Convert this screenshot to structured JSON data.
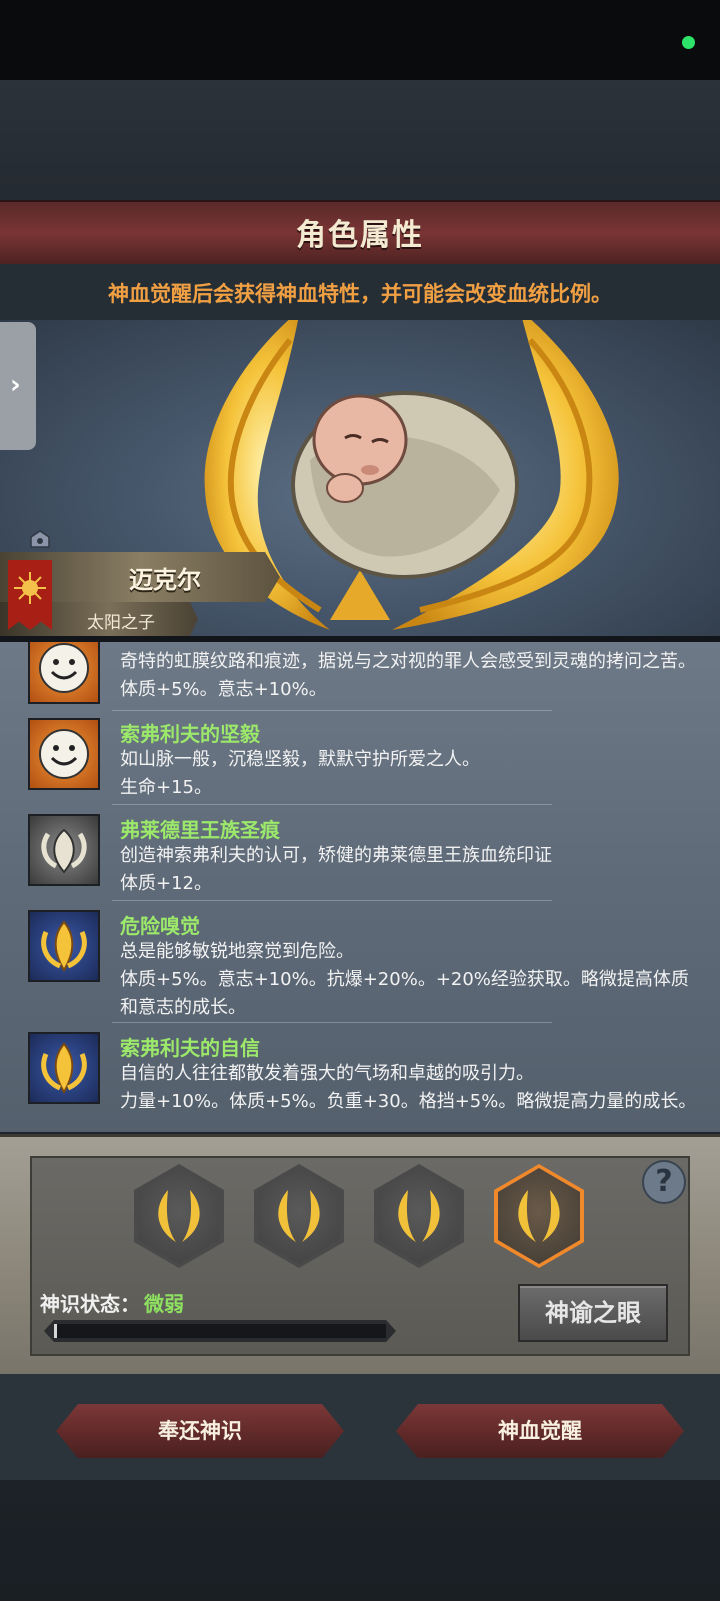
{
  "header": {
    "title": "角色属性",
    "subtitle": "神血觉醒后会获得神血特性，并可能会改变血统比例。"
  },
  "character": {
    "name": "迈克尔",
    "epithet": "太阳之子"
  },
  "traits": [
    {
      "name": "",
      "desc": "奇特的虹膜纹路和痕迹，据说与之对视的罪人会感受到灵魂的拷问之苦。",
      "effect": "体质+5%。意志+10%。",
      "icon": "smiley-face-icon"
    },
    {
      "name": "索弗利夫的坚毅",
      "desc": "如山脉一般，沉稳坚毅，默默守护所爱之人。",
      "effect": "生命+15。",
      "icon": "smiley-face-icon"
    },
    {
      "name": "弗莱德里王族圣痕",
      "desc": "创造神索弗利夫的认可，矫健的弗莱德里王族血统印证",
      "effect": "体质+12。",
      "icon": "horned-crest-icon"
    },
    {
      "name": "危险嗅觉",
      "desc": "总是能够敏锐地察觉到危险。",
      "effect": "体质+5%。意志+10%。抗爆+20%。+20%经验获取。略微提高体质和意志的成长。",
      "icon": "golden-flame-icon"
    },
    {
      "name": "索弗利夫的自信",
      "desc": "自信的人往往都散发着强大的气场和卓越的吸引力。",
      "effect": "力量+10%。体质+5%。负重+30。格挡+5%。略微提高力量的成长。",
      "icon": "golden-flame-icon"
    }
  ],
  "awakening": {
    "status_label": "神识状态：",
    "status_value": "微弱",
    "progress": 0.01,
    "oracle_button": "神谕之眼",
    "help_symbol": "?"
  },
  "actions": {
    "return_button": "奉还神识",
    "awaken_button": "神血觉醒"
  },
  "colors": {
    "accent_orange": "#f0a043",
    "trait_green": "#9be86a",
    "title_red": "#7a3434"
  }
}
